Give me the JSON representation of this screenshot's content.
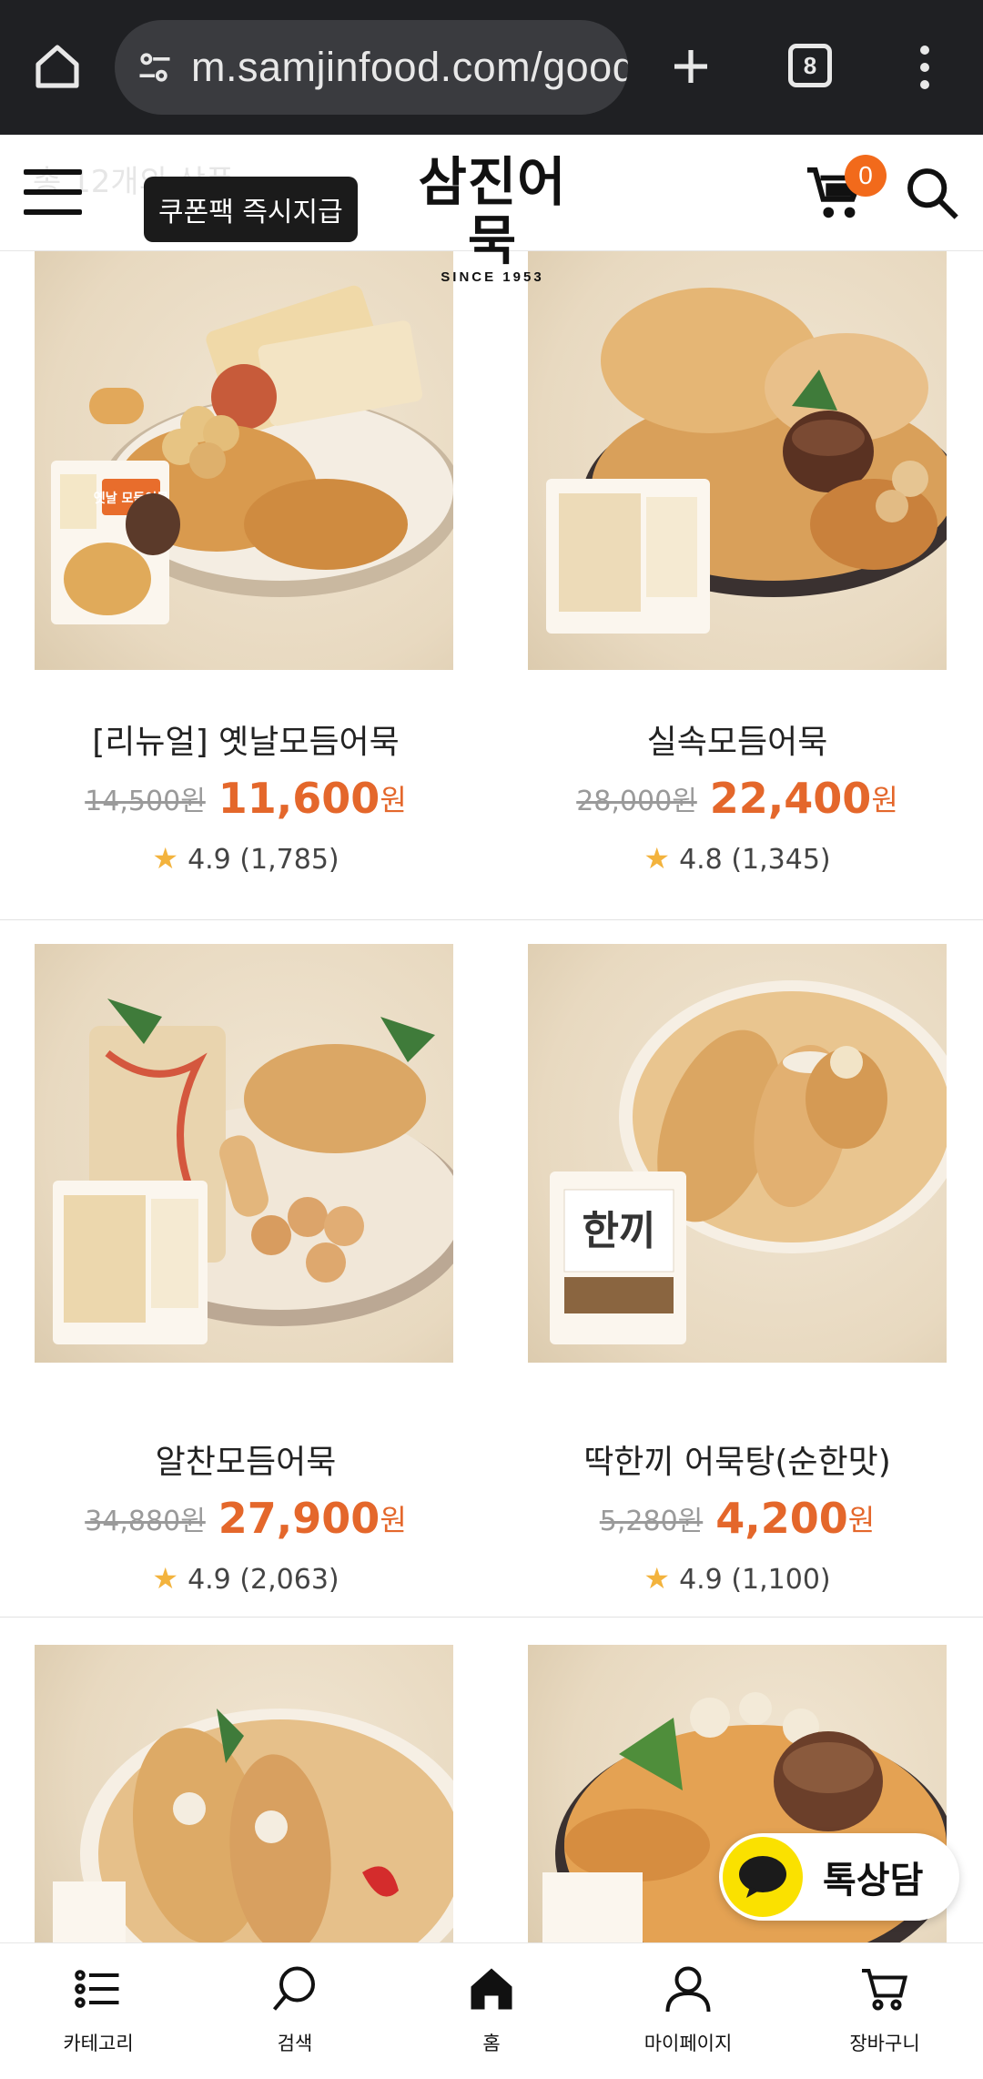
{
  "browser": {
    "url": "m.samjinfood.com/goods",
    "tab_count": "8"
  },
  "header": {
    "ghost_text": "총 12개의 상품",
    "coupon_badge": "쿠폰팩 즉시지급",
    "logo_main": "삼진어묵",
    "logo_sub": "SINCE 1953",
    "cart_count": "0"
  },
  "products": [
    {
      "title": "[리뉴얼] 옛날모듬어묵",
      "price_original": "14,500원",
      "price_sale": "11,600",
      "price_unit": "원",
      "rating": "4.9",
      "reviews": "(1,785)"
    },
    {
      "title": "실속모듬어묵",
      "price_original": "28,000원",
      "price_sale": "22,400",
      "price_unit": "원",
      "rating": "4.8",
      "reviews": "(1,345)"
    },
    {
      "title": "알찬모듬어묵",
      "price_original": "34,880원",
      "price_sale": "27,900",
      "price_unit": "원",
      "rating": "4.9",
      "reviews": "(2,063)"
    },
    {
      "title": "딱한끼 어묵탕(순한맛)",
      "price_original": "5,280원",
      "price_sale": "4,200",
      "price_unit": "원",
      "rating": "4.9",
      "reviews": "(1,100)"
    }
  ],
  "package_labels": {
    "p1": "옛날 모듬어묵",
    "p4": "한끼"
  },
  "talk": {
    "label": "톡상담"
  },
  "bottom_nav": [
    {
      "label": "카테고리",
      "icon": "list-icon"
    },
    {
      "label": "검색",
      "icon": "search-icon"
    },
    {
      "label": "홈",
      "icon": "home-icon"
    },
    {
      "label": "마이페이지",
      "icon": "user-icon"
    },
    {
      "label": "장바구니",
      "icon": "cart-icon"
    }
  ],
  "colors": {
    "accent_price": "#e4672b",
    "cart_badge": "#f26a1b",
    "kakao_yellow": "#fae100",
    "browser_bg": "#1f2023"
  }
}
